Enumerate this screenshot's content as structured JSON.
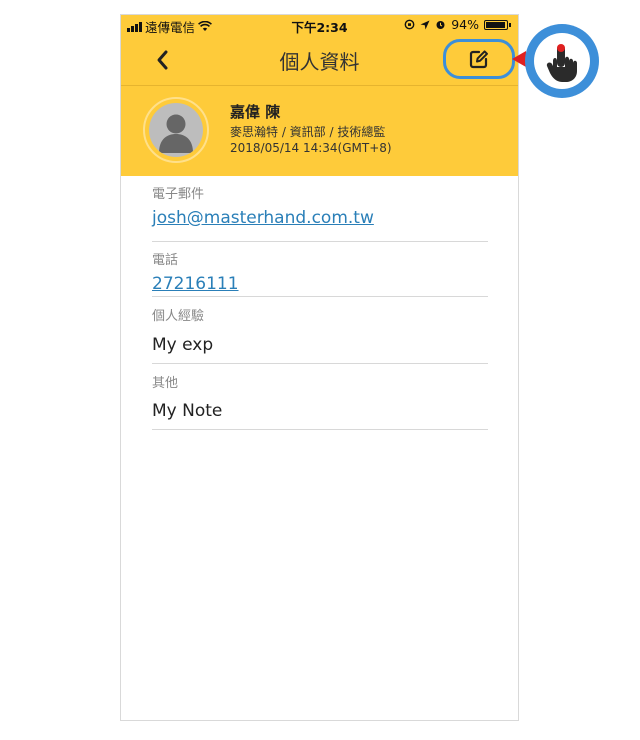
{
  "status_bar": {
    "carrier": "遠傳電信",
    "time": "下午2:34",
    "battery": "94%",
    "battery_level": 0.94
  },
  "nav": {
    "title": "個人資料",
    "back_icon": "chevron-left-icon",
    "edit_icon": "edit-icon"
  },
  "profile": {
    "name": "嘉偉 陳",
    "department": "麥思瀚特 / 資訊部 / 技術總監",
    "updated": "2018/05/14 14:34(GMT+8)"
  },
  "fields": {
    "email_label": "電子郵件",
    "email_value": "josh@masterhand.com.tw",
    "phone_label": "電話",
    "phone_value": "27216111",
    "experience_label": "個人經驗",
    "experience_value": "My exp",
    "other_label": "其他",
    "other_value": "My Note"
  },
  "colors": {
    "header": "#fecb3a",
    "highlight": "#3d8fd9",
    "link": "#2a7fb8",
    "pointer_arrow": "#e02020"
  }
}
